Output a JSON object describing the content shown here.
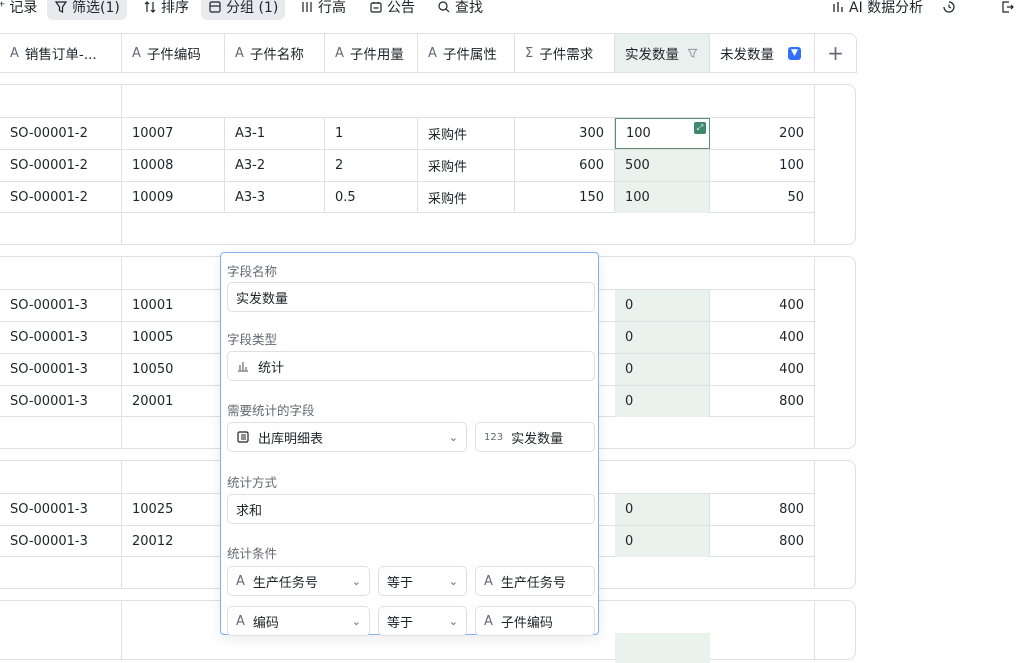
{
  "toolbar": {
    "record": "记录",
    "filter": "筛选(1)",
    "sort": "排序",
    "group": "分组 (1)",
    "row_height": "行高",
    "notice": "公告",
    "search": "查找",
    "ai": "AI 数据分析"
  },
  "columns": [
    {
      "icon": "A",
      "label": "销售订单-..."
    },
    {
      "icon": "A",
      "label": "子件编码"
    },
    {
      "icon": "A",
      "label": "子件名称"
    },
    {
      "icon": "A",
      "label": "子件用量"
    },
    {
      "icon": "A",
      "label": "子件属性"
    },
    {
      "icon": "Σ",
      "label": "子件需求"
    },
    {
      "icon": "",
      "label": "实发数量"
    },
    {
      "icon": "",
      "label": "未发数量"
    }
  ],
  "groups": [
    {
      "rows": [
        [
          "SO-00001-2",
          "10007",
          "A3-1",
          "1",
          "采购件",
          "300",
          "100",
          "200"
        ],
        [
          "SO-00001-2",
          "10008",
          "A3-2",
          "2",
          "采购件",
          "600",
          "500",
          "100"
        ],
        [
          "SO-00001-2",
          "10009",
          "A3-3",
          "0.5",
          "采购件",
          "150",
          "100",
          "50"
        ]
      ]
    },
    {
      "rows": [
        [
          "SO-00001-3",
          "10001",
          "",
          "",
          "",
          "",
          "0",
          "400"
        ],
        [
          "SO-00001-3",
          "10005",
          "",
          "",
          "",
          "",
          "0",
          "400"
        ],
        [
          "SO-00001-3",
          "10050",
          "",
          "",
          "",
          "",
          "0",
          "400"
        ],
        [
          "SO-00001-3",
          "20001",
          "",
          "",
          "",
          "",
          "0",
          "800"
        ]
      ]
    },
    {
      "rows": [
        [
          "SO-00001-3",
          "10025",
          "",
          "",
          "",
          "",
          "0",
          "800"
        ],
        [
          "SO-00001-3",
          "20012",
          "",
          "",
          "",
          "",
          "0",
          "800"
        ]
      ]
    }
  ],
  "panel": {
    "field_name_label": "字段名称",
    "field_name_value": "实发数量",
    "field_type_label": "字段类型",
    "field_type_value": "统计",
    "stat_field_label": "需要统计的字段",
    "stat_table": "出库明细表",
    "stat_field": "实发数量",
    "stat_field_prefix": "123",
    "method_label": "统计方式",
    "method_value": "求和",
    "cond_label": "统计条件",
    "cond1_field": "生产任务号",
    "cond1_op": "等于",
    "cond1_value": "生产任务号",
    "cond2_field": "编码",
    "cond2_op": "等于",
    "cond2_value": "子件编码"
  }
}
